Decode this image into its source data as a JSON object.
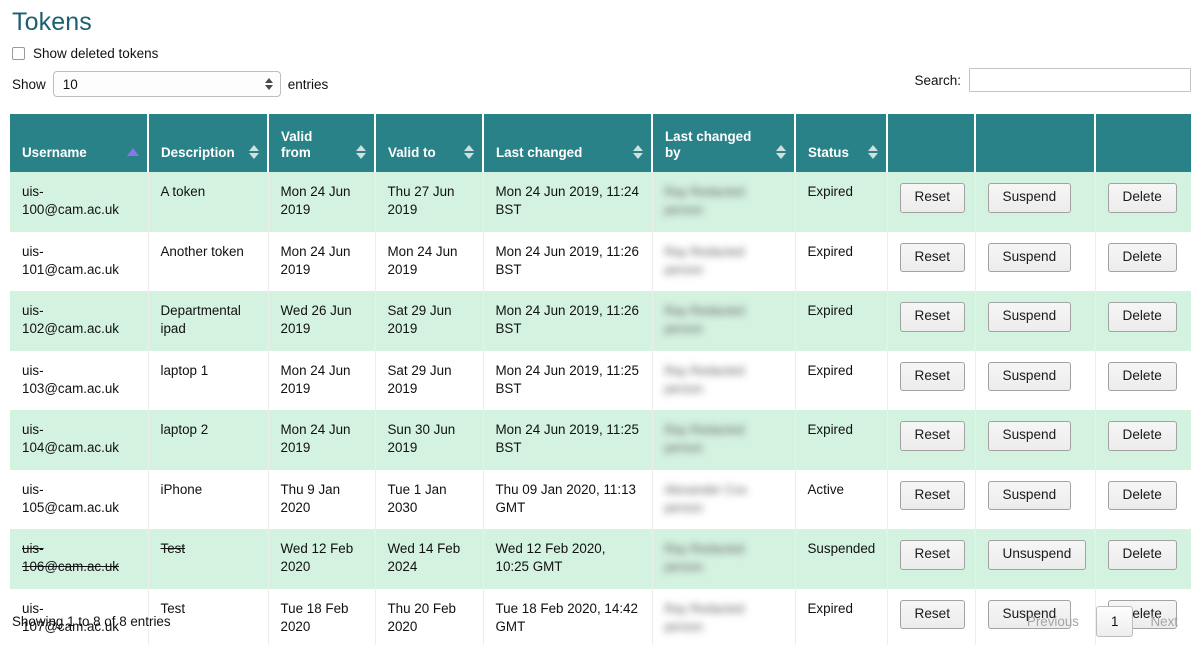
{
  "page": {
    "title": "Tokens"
  },
  "controls": {
    "show_deleted_label": "Show deleted tokens",
    "show_deleted_checked": false,
    "show_label": "Show",
    "entries_label": "entries",
    "page_length_value": "10",
    "search_label": "Search:",
    "search_value": "",
    "search_placeholder": ""
  },
  "table": {
    "columns": [
      {
        "label": "Username",
        "sort": "asc"
      },
      {
        "label": "Description",
        "sort": "none"
      },
      {
        "label": "Valid\nfrom",
        "sort": "none"
      },
      {
        "label": "Valid to",
        "sort": "none"
      },
      {
        "label": "Last changed",
        "sort": "none"
      },
      {
        "label": "Last changed\nby",
        "sort": "none"
      },
      {
        "label": "Status",
        "sort": "none"
      },
      {
        "label": "",
        "sort": "hidden"
      },
      {
        "label": "",
        "sort": "hidden"
      },
      {
        "label": "",
        "sort": "hidden"
      }
    ],
    "rows": [
      {
        "username": "uis-100@cam.ac.uk",
        "description": "A token",
        "valid_from": "Mon 24 Jun 2019",
        "valid_to": "Thu 27 Jun 2019",
        "last_changed": "Mon 24 Jun 2019, 11:24 BST",
        "last_changed_by": "Ray Redacted\nperson",
        "status": "Expired",
        "deleted": false,
        "actions": [
          "Reset",
          "Suspend",
          "Delete"
        ]
      },
      {
        "username": "uis-101@cam.ac.uk",
        "description": "Another token",
        "valid_from": "Mon 24 Jun 2019",
        "valid_to": "Mon 24 Jun 2019",
        "last_changed": "Mon 24 Jun 2019, 11:26 BST",
        "last_changed_by": "Ray Redacted\nperson",
        "status": "Expired",
        "deleted": false,
        "actions": [
          "Reset",
          "Suspend",
          "Delete"
        ]
      },
      {
        "username": "uis-102@cam.ac.uk",
        "description": "Departmental ipad",
        "valid_from": "Wed 26 Jun 2019",
        "valid_to": "Sat 29 Jun 2019",
        "last_changed": "Mon 24 Jun 2019, 11:26 BST",
        "last_changed_by": "Ray Redacted\nperson",
        "status": "Expired",
        "deleted": false,
        "actions": [
          "Reset",
          "Suspend",
          "Delete"
        ]
      },
      {
        "username": "uis-103@cam.ac.uk",
        "description": "laptop 1",
        "valid_from": "Mon 24 Jun 2019",
        "valid_to": "Sat 29 Jun 2019",
        "last_changed": "Mon 24 Jun 2019, 11:25 BST",
        "last_changed_by": "Ray Redacted\nperson",
        "status": "Expired",
        "deleted": false,
        "actions": [
          "Reset",
          "Suspend",
          "Delete"
        ]
      },
      {
        "username": "uis-104@cam.ac.uk",
        "description": "laptop 2",
        "valid_from": "Mon 24 Jun 2019",
        "valid_to": "Sun 30 Jun 2019",
        "last_changed": "Mon 24 Jun 2019, 11:25 BST",
        "last_changed_by": "Ray Redacted\nperson",
        "status": "Expired",
        "deleted": false,
        "actions": [
          "Reset",
          "Suspend",
          "Delete"
        ]
      },
      {
        "username": "uis-105@cam.ac.uk",
        "description": "iPhone",
        "valid_from": "Thu 9 Jan 2020",
        "valid_to": "Tue 1 Jan 2030",
        "last_changed": "Thu 09 Jan 2020, 11:13 GMT",
        "last_changed_by": "Alexander Cox\nperson",
        "status": "Active",
        "deleted": false,
        "actions": [
          "Reset",
          "Suspend",
          "Delete"
        ]
      },
      {
        "username": "uis-106@cam.ac.uk",
        "description": "Test",
        "valid_from": "Wed 12 Feb 2020",
        "valid_to": "Wed 14 Feb 2024",
        "last_changed": "Wed 12 Feb 2020, 10:25 GMT",
        "last_changed_by": "Ray Redacted\nperson",
        "status": "Suspended",
        "deleted": true,
        "actions": [
          "Reset",
          "Unsuspend",
          "Delete"
        ]
      },
      {
        "username": "uis-107@cam.ac.uk",
        "description": "Test",
        "valid_from": "Tue 18 Feb 2020",
        "valid_to": "Thu 20 Feb 2020",
        "last_changed": "Tue 18 Feb 2020, 14:42 GMT",
        "last_changed_by": "Ray Redacted\nperson",
        "status": "Expired",
        "deleted": false,
        "actions": [
          "Reset",
          "Suspend",
          "Delete"
        ]
      }
    ]
  },
  "footer": {
    "info": "Showing 1 to 8 of 8 entries",
    "previous_label": "Previous",
    "current_page": "1",
    "next_label": "Next"
  },
  "colors": {
    "header_teal": "#2a8289",
    "title_teal": "#1d5f70",
    "row_alt_green": "#d4f2e0",
    "sort_active_purple": "#8b76e8"
  }
}
